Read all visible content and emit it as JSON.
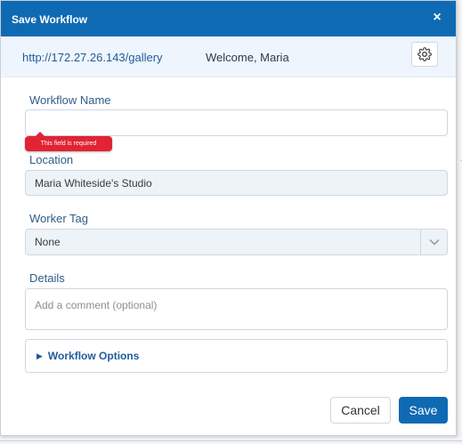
{
  "dialog": {
    "title": "Save Workflow",
    "close_symbol": "×"
  },
  "infobar": {
    "url": "http://172.27.26.143/gallery",
    "welcome": "Welcome, Maria",
    "settings_icon": "gear-icon"
  },
  "form": {
    "workflow_name": {
      "label": "Workflow Name",
      "value": "",
      "error": "This field is required"
    },
    "location": {
      "label": "Location",
      "value": "Maria Whiteside's Studio"
    },
    "worker_tag": {
      "label": "Worker Tag",
      "selected": "None"
    },
    "details": {
      "label": "Details",
      "placeholder": "Add a comment (optional)"
    },
    "options": {
      "label": "Workflow Options",
      "expanded": false
    }
  },
  "buttons": {
    "cancel": "Cancel",
    "save": "Save"
  },
  "colors": {
    "primary": "#0f6ab4",
    "error": "#e02434",
    "label": "#2f5d86"
  }
}
